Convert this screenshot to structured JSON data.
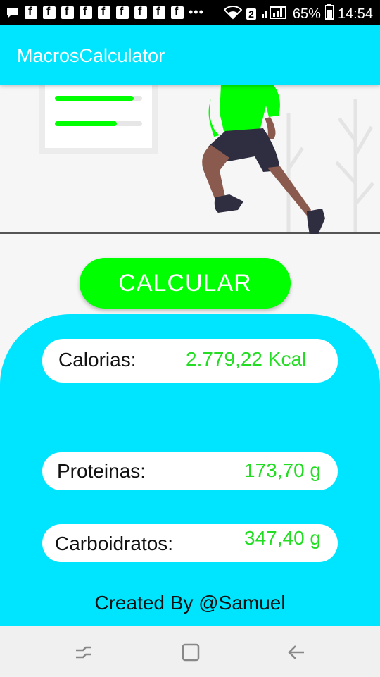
{
  "status_bar": {
    "battery": "65%",
    "time": "14:54",
    "wifi_badge": "2",
    "icons": [
      "message-icon",
      "facebook-icon",
      "facebook-icon",
      "facebook-icon",
      "facebook-icon",
      "facebook-icon",
      "facebook-icon",
      "facebook-icon",
      "facebook-icon",
      "facebook-icon",
      "more-dots-icon",
      "wifi-icon",
      "signal-icon",
      "battery-icon"
    ]
  },
  "app_bar": {
    "title": "MacrosCalculator"
  },
  "hero": {
    "illustration": "running-person-illustration"
  },
  "calculate_button": {
    "label": "CALCULAR"
  },
  "results": [
    {
      "label": "Calorias:",
      "value": "2.779,22 Kcal"
    },
    {
      "label": "Proteinas:",
      "value": "173,70 g"
    },
    {
      "label": "Carboidratos:",
      "value": "347,40 g"
    }
  ],
  "footer": {
    "credit": "Created By @Samuel"
  },
  "nav_bar": {
    "icons": [
      "recent-apps-icon",
      "home-icon",
      "back-icon"
    ]
  },
  "colors": {
    "accent": "#00e5ff",
    "button": "#00ff00",
    "value_text": "#22dd22",
    "shirt": "#00ff00"
  }
}
